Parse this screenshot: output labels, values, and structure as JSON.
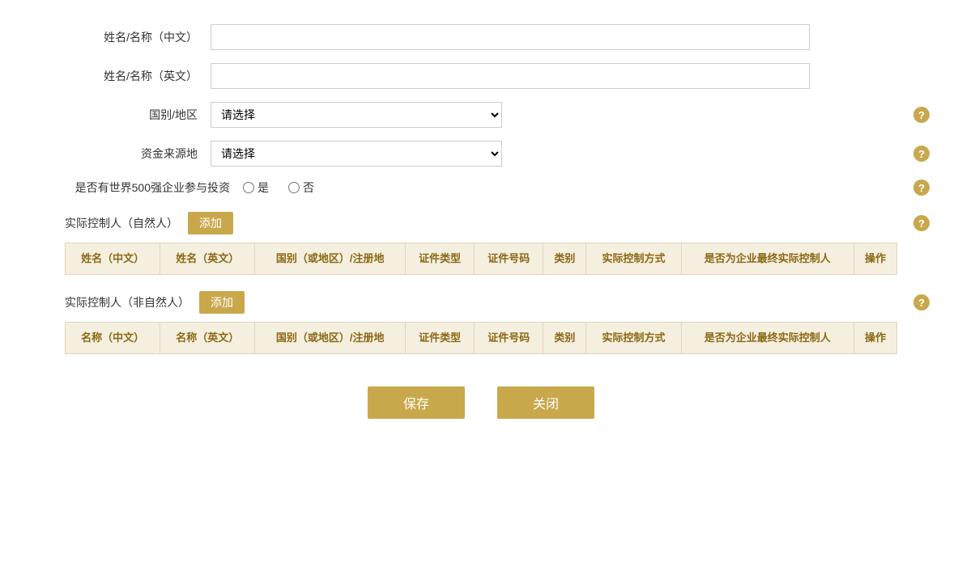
{
  "form": {
    "name_cn_label": "姓名/名称（中文）",
    "name_en_label": "姓名/名称（英文）",
    "country_label": "国别/地区",
    "fund_source_label": "资金来源地",
    "fortune500_label": "是否有世界500强企业参与投资",
    "country_placeholder": "请选择",
    "fund_source_placeholder": "请选择",
    "yes_label": "是",
    "no_label": "否"
  },
  "natural_person_section": {
    "title": "实际控制人（自然人）",
    "add_label": "添加",
    "columns": [
      "姓名（中文）",
      "姓名（英文）",
      "国别（或地区）/注册地",
      "证件类型",
      "证件号码",
      "类别",
      "实际控制方式",
      "是否为企业最终实际控制人",
      "操作"
    ]
  },
  "non_natural_person_section": {
    "title": "实际控制人（非自然人）",
    "add_label": "添加",
    "columns": [
      "名称（中文）",
      "名称（英文）",
      "国别（或地区）/注册地",
      "证件类型",
      "证件号码",
      "类别",
      "实际控制方式",
      "是否为企业最终实际控制人",
      "操作"
    ]
  },
  "buttons": {
    "save": "保存",
    "close": "关闭"
  },
  "help_icon_char": "?",
  "colors": {
    "gold": "#c9a84c",
    "table_header_bg": "#f5efe0",
    "table_header_text": "#8b6914",
    "table_border": "#e0d5c0"
  }
}
